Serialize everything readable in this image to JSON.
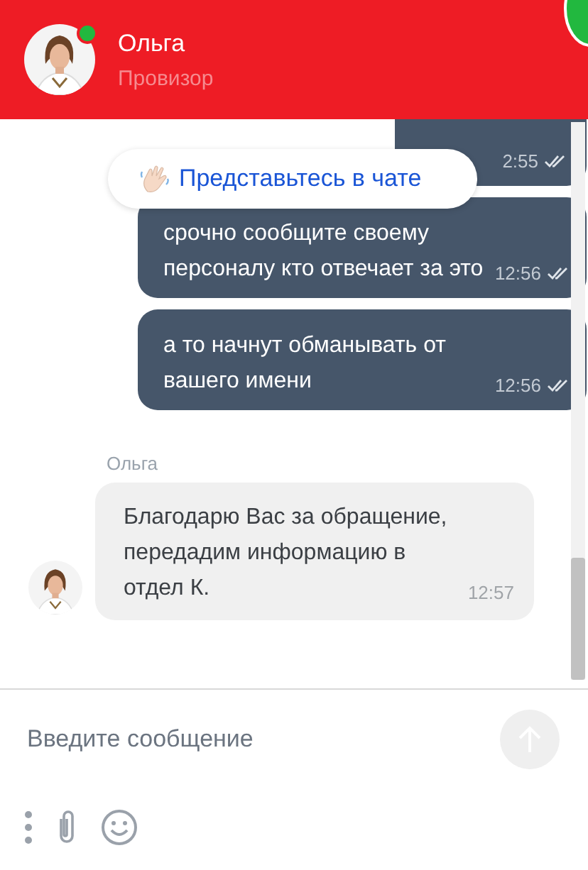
{
  "header": {
    "name": "Ольга",
    "role": "Провизор",
    "online": true
  },
  "prompt": {
    "text": "Представьтесь в чате"
  },
  "messages": [
    {
      "kind": "partial",
      "time": "2:55",
      "read": true
    },
    {
      "kind": "outgoing",
      "text": "срочно сообщите своему персоналу кто отвечает за это",
      "time": "12:56",
      "read": true
    },
    {
      "kind": "outgoing",
      "text": "а то начнут обманывать от вашего имени",
      "time": "12:56",
      "read": true
    },
    {
      "kind": "sender",
      "text": "Ольга"
    },
    {
      "kind": "incoming",
      "text": "Благодарю Вас за обращение, передадим информацию в отдел К.",
      "time": "12:57"
    }
  ],
  "composer": {
    "placeholder": "Введите сообщение"
  }
}
